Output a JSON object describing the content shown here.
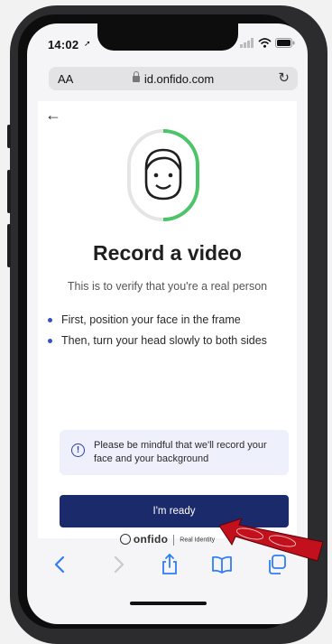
{
  "status_bar": {
    "time": "14:02"
  },
  "browser": {
    "text_size_label": "AA",
    "url": "id.onfido.com"
  },
  "page": {
    "title": "Record a video",
    "subtitle": "This is to verify that you're a real person",
    "instructions": [
      "First, position your face in the frame",
      "Then, turn your head slowly to both sides"
    ],
    "notice": "Please be mindful that we'll record your face and your background",
    "primary_button": "I'm ready",
    "brand": {
      "name": "onfido",
      "tagline": "Real Identity"
    }
  },
  "toolbar_icons": [
    "back-icon",
    "forward-icon",
    "share-icon",
    "bookmarks-icon",
    "tabs-icon"
  ],
  "colors": {
    "accent": "#1b2a6b",
    "bullet": "#3451c6",
    "face_frame": "#4cc46a",
    "notice_bg": "#eef0fc",
    "annotation_arrow": "#c2101c"
  }
}
